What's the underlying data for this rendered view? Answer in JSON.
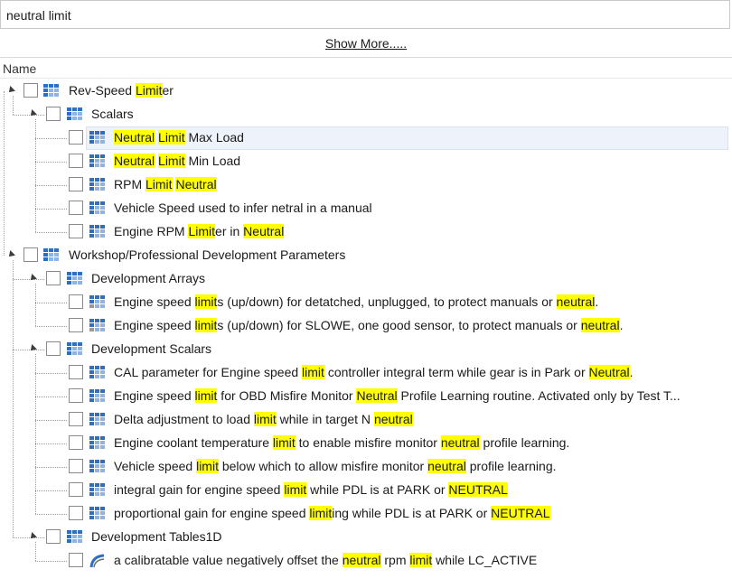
{
  "search": {
    "value": "neutral limit"
  },
  "show_more_label": "Show More.....",
  "header": {
    "name_label": "Name"
  },
  "colors": {
    "highlight": "#ffff00",
    "selection": "#eef3fb",
    "icon_blue": "#2f6fc1"
  },
  "tree": [
    {
      "level": 0,
      "expander": true,
      "icon": "table-grid-icon",
      "segments": [
        {
          "t": "Rev-Speed "
        },
        {
          "t": "Limit",
          "h": true
        },
        {
          "t": "er"
        }
      ]
    },
    {
      "level": 1,
      "expander": true,
      "icon": "table-grid-icon",
      "segments": [
        {
          "t": "Scalars"
        }
      ]
    },
    {
      "level": 2,
      "expander": false,
      "icon": "scalar-icon",
      "selected": true,
      "segments": [
        {
          "t": "Neutral",
          "h": true
        },
        {
          "t": " "
        },
        {
          "t": "Limit",
          "h": true
        },
        {
          "t": " Max Load"
        }
      ]
    },
    {
      "level": 2,
      "expander": false,
      "icon": "scalar-icon",
      "segments": [
        {
          "t": "Neutral",
          "h": true
        },
        {
          "t": " "
        },
        {
          "t": "Limit",
          "h": true
        },
        {
          "t": " Min Load"
        }
      ]
    },
    {
      "level": 2,
      "expander": false,
      "icon": "scalar-icon",
      "segments": [
        {
          "t": "RPM "
        },
        {
          "t": "Limit",
          "h": true
        },
        {
          "t": " "
        },
        {
          "t": "Neutral",
          "h": true
        }
      ]
    },
    {
      "level": 2,
      "expander": false,
      "icon": "scalar-icon",
      "segments": [
        {
          "t": "Vehicle Speed used to infer netral in a manual"
        }
      ]
    },
    {
      "level": 2,
      "expander": false,
      "icon": "scalar-icon",
      "segments": [
        {
          "t": "Engine RPM "
        },
        {
          "t": "Limit",
          "h": true
        },
        {
          "t": "er in "
        },
        {
          "t": "Neutral",
          "h": true
        }
      ]
    },
    {
      "level": 0,
      "expander": true,
      "icon": "table-grid-icon",
      "segments": [
        {
          "t": "Workshop/Professional Development Parameters"
        }
      ]
    },
    {
      "level": 1,
      "expander": true,
      "icon": "table-grid-icon",
      "segments": [
        {
          "t": "Development Arrays"
        }
      ]
    },
    {
      "level": 2,
      "expander": false,
      "icon": "array-icon",
      "segments": [
        {
          "t": "Engine speed "
        },
        {
          "t": "limit",
          "h": true
        },
        {
          "t": "s (up/down) for detatched, unplugged, to protect manuals or "
        },
        {
          "t": "neutral",
          "h": true
        },
        {
          "t": "."
        }
      ]
    },
    {
      "level": 2,
      "expander": false,
      "icon": "array-icon",
      "segments": [
        {
          "t": "Engine speed "
        },
        {
          "t": "limit",
          "h": true
        },
        {
          "t": "s (up/down) for SLOWE, one good sensor, to protect manuals or "
        },
        {
          "t": "neutral",
          "h": true
        },
        {
          "t": "."
        }
      ]
    },
    {
      "level": 1,
      "expander": true,
      "icon": "table-grid-icon",
      "segments": [
        {
          "t": "Development Scalars"
        }
      ]
    },
    {
      "level": 2,
      "expander": false,
      "icon": "scalar-icon",
      "segments": [
        {
          "t": "CAL parameter for Engine speed "
        },
        {
          "t": "limit",
          "h": true
        },
        {
          "t": " controller integral term while gear is in Park or "
        },
        {
          "t": "Neutral",
          "h": true
        },
        {
          "t": "."
        }
      ]
    },
    {
      "level": 2,
      "expander": false,
      "icon": "scalar-icon",
      "segments": [
        {
          "t": "Engine speed "
        },
        {
          "t": "limit",
          "h": true
        },
        {
          "t": " for OBD Misfire Monitor "
        },
        {
          "t": "Neutral",
          "h": true
        },
        {
          "t": " Profile Learning routine.  Activated only by Test T..."
        }
      ]
    },
    {
      "level": 2,
      "expander": false,
      "icon": "scalar-icon",
      "segments": [
        {
          "t": "Delta adjustment to load "
        },
        {
          "t": "limit",
          "h": true
        },
        {
          "t": " while in target N "
        },
        {
          "t": "neutral",
          "h": true
        }
      ]
    },
    {
      "level": 2,
      "expander": false,
      "icon": "scalar-icon",
      "segments": [
        {
          "t": "Engine coolant temperature "
        },
        {
          "t": "limit",
          "h": true
        },
        {
          "t": " to enable misfire monitor "
        },
        {
          "t": "neutral",
          "h": true
        },
        {
          "t": " profile learning."
        }
      ]
    },
    {
      "level": 2,
      "expander": false,
      "icon": "scalar-icon",
      "segments": [
        {
          "t": "Vehicle speed "
        },
        {
          "t": "limit",
          "h": true
        },
        {
          "t": " below which to allow misfire monitor "
        },
        {
          "t": "neutral",
          "h": true
        },
        {
          "t": " profile learning."
        }
      ]
    },
    {
      "level": 2,
      "expander": false,
      "icon": "scalar-icon",
      "segments": [
        {
          "t": "integral gain for engine speed "
        },
        {
          "t": "limit",
          "h": true
        },
        {
          "t": " while PDL is at PARK or "
        },
        {
          "t": "NEUTRAL",
          "h": true
        }
      ]
    },
    {
      "level": 2,
      "expander": false,
      "icon": "scalar-icon",
      "segments": [
        {
          "t": "proportional gain for engine speed "
        },
        {
          "t": "limit",
          "h": true
        },
        {
          "t": "ing while PDL is at PARK or "
        },
        {
          "t": "NEUTRAL",
          "h": true
        }
      ]
    },
    {
      "level": 1,
      "expander": true,
      "icon": "table-grid-icon",
      "segments": [
        {
          "t": "Development Tables1D"
        }
      ]
    },
    {
      "level": 2,
      "expander": false,
      "icon": "curve-icon",
      "segments": [
        {
          "t": "a calibratable value negatively  offset the "
        },
        {
          "t": "neutral",
          "h": true
        },
        {
          "t": " rpm "
        },
        {
          "t": "limit",
          "h": true
        },
        {
          "t": " while LC_ACTIVE"
        }
      ]
    }
  ]
}
